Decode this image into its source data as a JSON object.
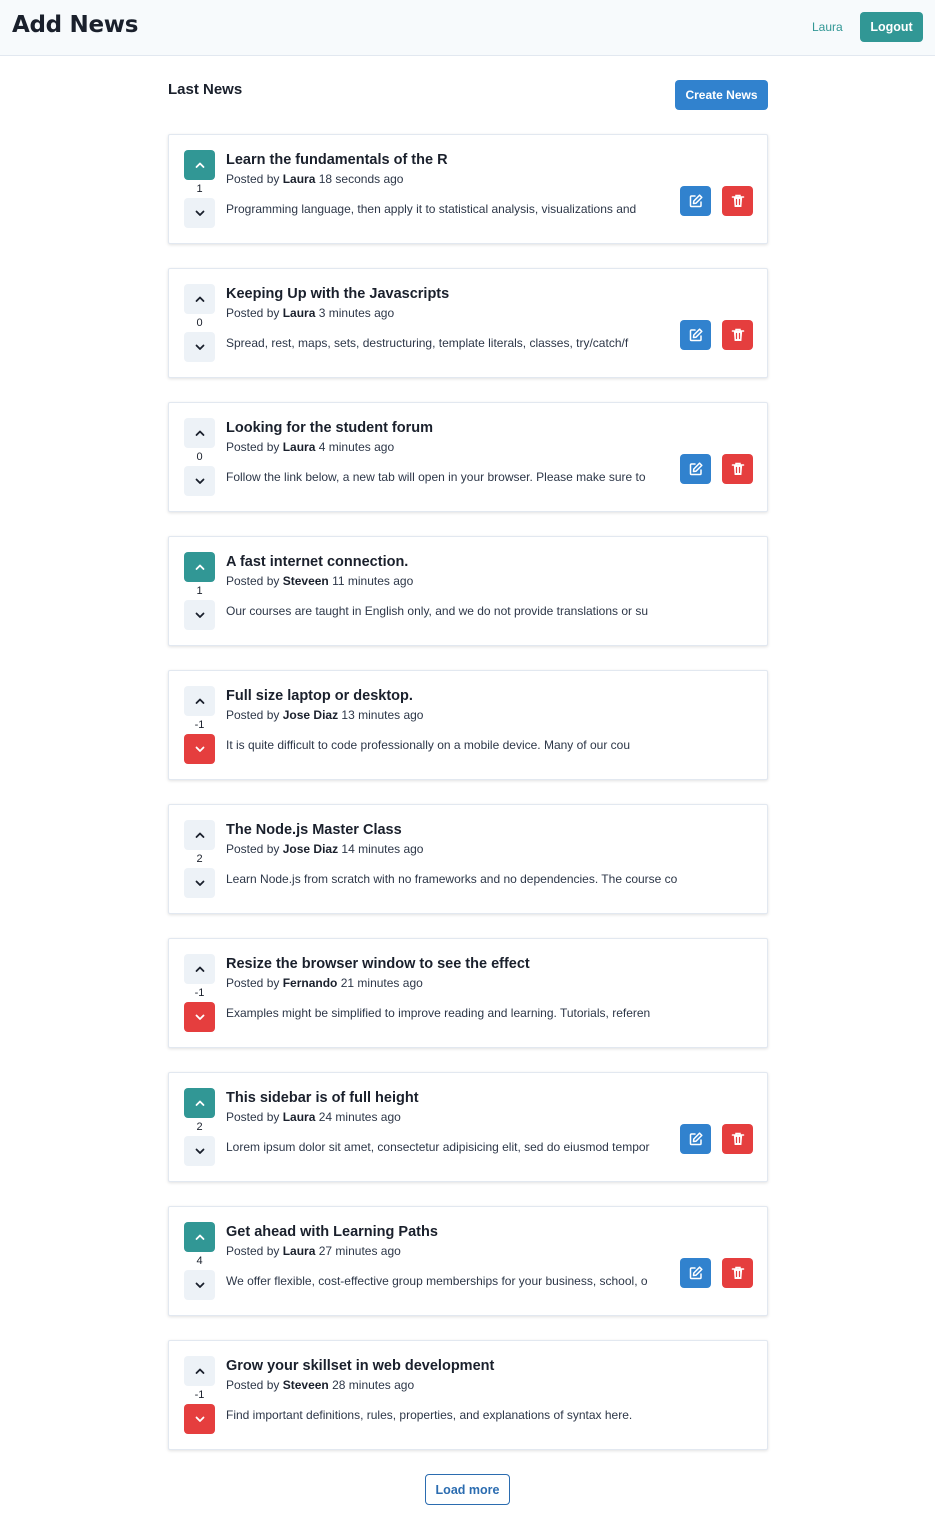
{
  "header": {
    "title": "Add News",
    "user": "Laura",
    "logout_label": "Logout"
  },
  "main": {
    "section_title": "Last News",
    "create_label": "Create News",
    "posted_prefix": "Posted by",
    "load_more_label": "Load more"
  },
  "colors": {
    "primary_teal": "#319795",
    "primary_blue": "#3182ce",
    "danger_red": "#e53e3e",
    "neutral_button": "#edf2f7"
  },
  "icons": {
    "upvote": "chevron-up-icon",
    "downvote": "chevron-down-icon",
    "edit": "edit-icon",
    "delete": "trash-icon"
  },
  "news": [
    {
      "title": "Learn the fundamentals of the R",
      "author": "Laura",
      "time": "18 seconds ago",
      "excerpt": "Programming language, then apply it to statistical analysis, visualizations and",
      "votes": "1",
      "vote_state": "up",
      "editable": true
    },
    {
      "title": "Keeping Up with the Javascripts",
      "author": "Laura",
      "time": "3 minutes ago",
      "excerpt": "Spread, rest, maps, sets, destructuring, template literals, classes, try/catch/f",
      "votes": "0",
      "vote_state": "none",
      "editable": true
    },
    {
      "title": "Looking for the student forum",
      "author": "Laura",
      "time": "4 minutes ago",
      "excerpt": "Follow the link below, a new tab will open in your browser. Please make sure to",
      "votes": "0",
      "vote_state": "none",
      "editable": true
    },
    {
      "title": "A fast internet connection.",
      "author": "Steveen",
      "time": "11 minutes ago",
      "excerpt": "Our courses are taught in English only, and we do not provide translations or su",
      "votes": "1",
      "vote_state": "up",
      "editable": false
    },
    {
      "title": "Full size laptop or desktop.",
      "author": "Jose Diaz",
      "time": "13 minutes ago",
      "excerpt": "It is quite difficult to code professionally on a mobile device. Many of our cou",
      "votes": "-1",
      "vote_state": "down",
      "editable": false
    },
    {
      "title": "The Node.js Master Class",
      "author": "Jose Diaz",
      "time": "14 minutes ago",
      "excerpt": "Learn Node.js from scratch with no frameworks and no dependencies. The course co",
      "votes": "2",
      "vote_state": "none",
      "editable": false
    },
    {
      "title": "Resize the browser window to see the effect",
      "author": "Fernando",
      "time": "21 minutes ago",
      "excerpt": "Examples might be simplified to improve reading and learning. Tutorials, referen",
      "votes": "-1",
      "vote_state": "down",
      "editable": false
    },
    {
      "title": "This sidebar is of full height",
      "author": "Laura",
      "time": "24 minutes ago",
      "excerpt": "Lorem ipsum dolor sit amet, consectetur adipisicing elit, sed do eiusmod tempor",
      "votes": "2",
      "vote_state": "up",
      "editable": true
    },
    {
      "title": "Get ahead with Learning Paths",
      "author": "Laura",
      "time": "27 minutes ago",
      "excerpt": "We offer flexible, cost-effective group memberships for your business, school, o",
      "votes": "4",
      "vote_state": "up",
      "editable": true
    },
    {
      "title": "Grow your skillset in web development",
      "author": "Steveen",
      "time": "28 minutes ago",
      "excerpt": "Find important definitions, rules, properties, and explanations of syntax here.",
      "votes": "-1",
      "vote_state": "down",
      "editable": false
    }
  ]
}
